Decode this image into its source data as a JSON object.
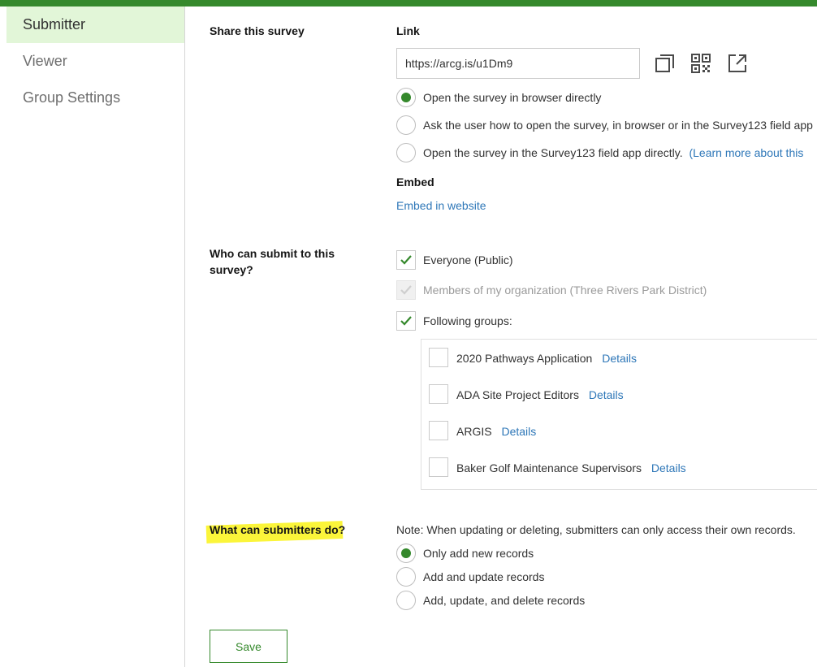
{
  "colors": {
    "accent": "#35892c",
    "link": "#2e77b8",
    "highlight": "#fbf53a"
  },
  "sidebar": {
    "items": [
      {
        "label": "Submitter",
        "active": true
      },
      {
        "label": "Viewer",
        "active": false
      },
      {
        "label": "Group Settings",
        "active": false
      }
    ]
  },
  "share": {
    "section_label": "Share this survey",
    "link_label": "Link",
    "link_value": "https://arcg.is/u1Dm9",
    "icons": [
      "copy-icon",
      "qr-code-icon",
      "open-external-icon"
    ],
    "open_options": [
      {
        "label": "Open the survey in browser directly",
        "selected": true
      },
      {
        "label": "Ask the user how to open the survey, in browser or in the Survey123 field app",
        "selected": false
      },
      {
        "label": "Open the survey in the Survey123 field app directly.",
        "selected": false,
        "link": "(Learn more about this"
      }
    ],
    "embed_label": "Embed",
    "embed_link": "Embed in website"
  },
  "submit": {
    "section_label_line1": "Who can submit to this",
    "section_label_line2": "survey?",
    "options": [
      {
        "label": "Everyone (Public)",
        "checked": true,
        "disabled": false
      },
      {
        "label": "Members of my organization (Three Rivers Park District)",
        "checked": true,
        "disabled": true
      },
      {
        "label": "Following groups:",
        "checked": true,
        "disabled": false
      }
    ],
    "groups": [
      {
        "name": "2020 Pathways Application",
        "details": "Details",
        "checked": false
      },
      {
        "name": "ADA Site Project Editors",
        "details": "Details",
        "checked": false
      },
      {
        "name": "ARGIS",
        "details": "Details",
        "checked": false
      },
      {
        "name": "Baker Golf Maintenance Supervisors",
        "details": "Details",
        "checked": false
      }
    ]
  },
  "permissions": {
    "section_label": "What can submitters do?",
    "note": "Note: When updating or deleting, submitters can only access their own records.",
    "options": [
      {
        "label": "Only add new records",
        "selected": true
      },
      {
        "label": "Add and update records",
        "selected": false
      },
      {
        "label": "Add, update, and delete records",
        "selected": false
      }
    ]
  },
  "save_label": "Save"
}
